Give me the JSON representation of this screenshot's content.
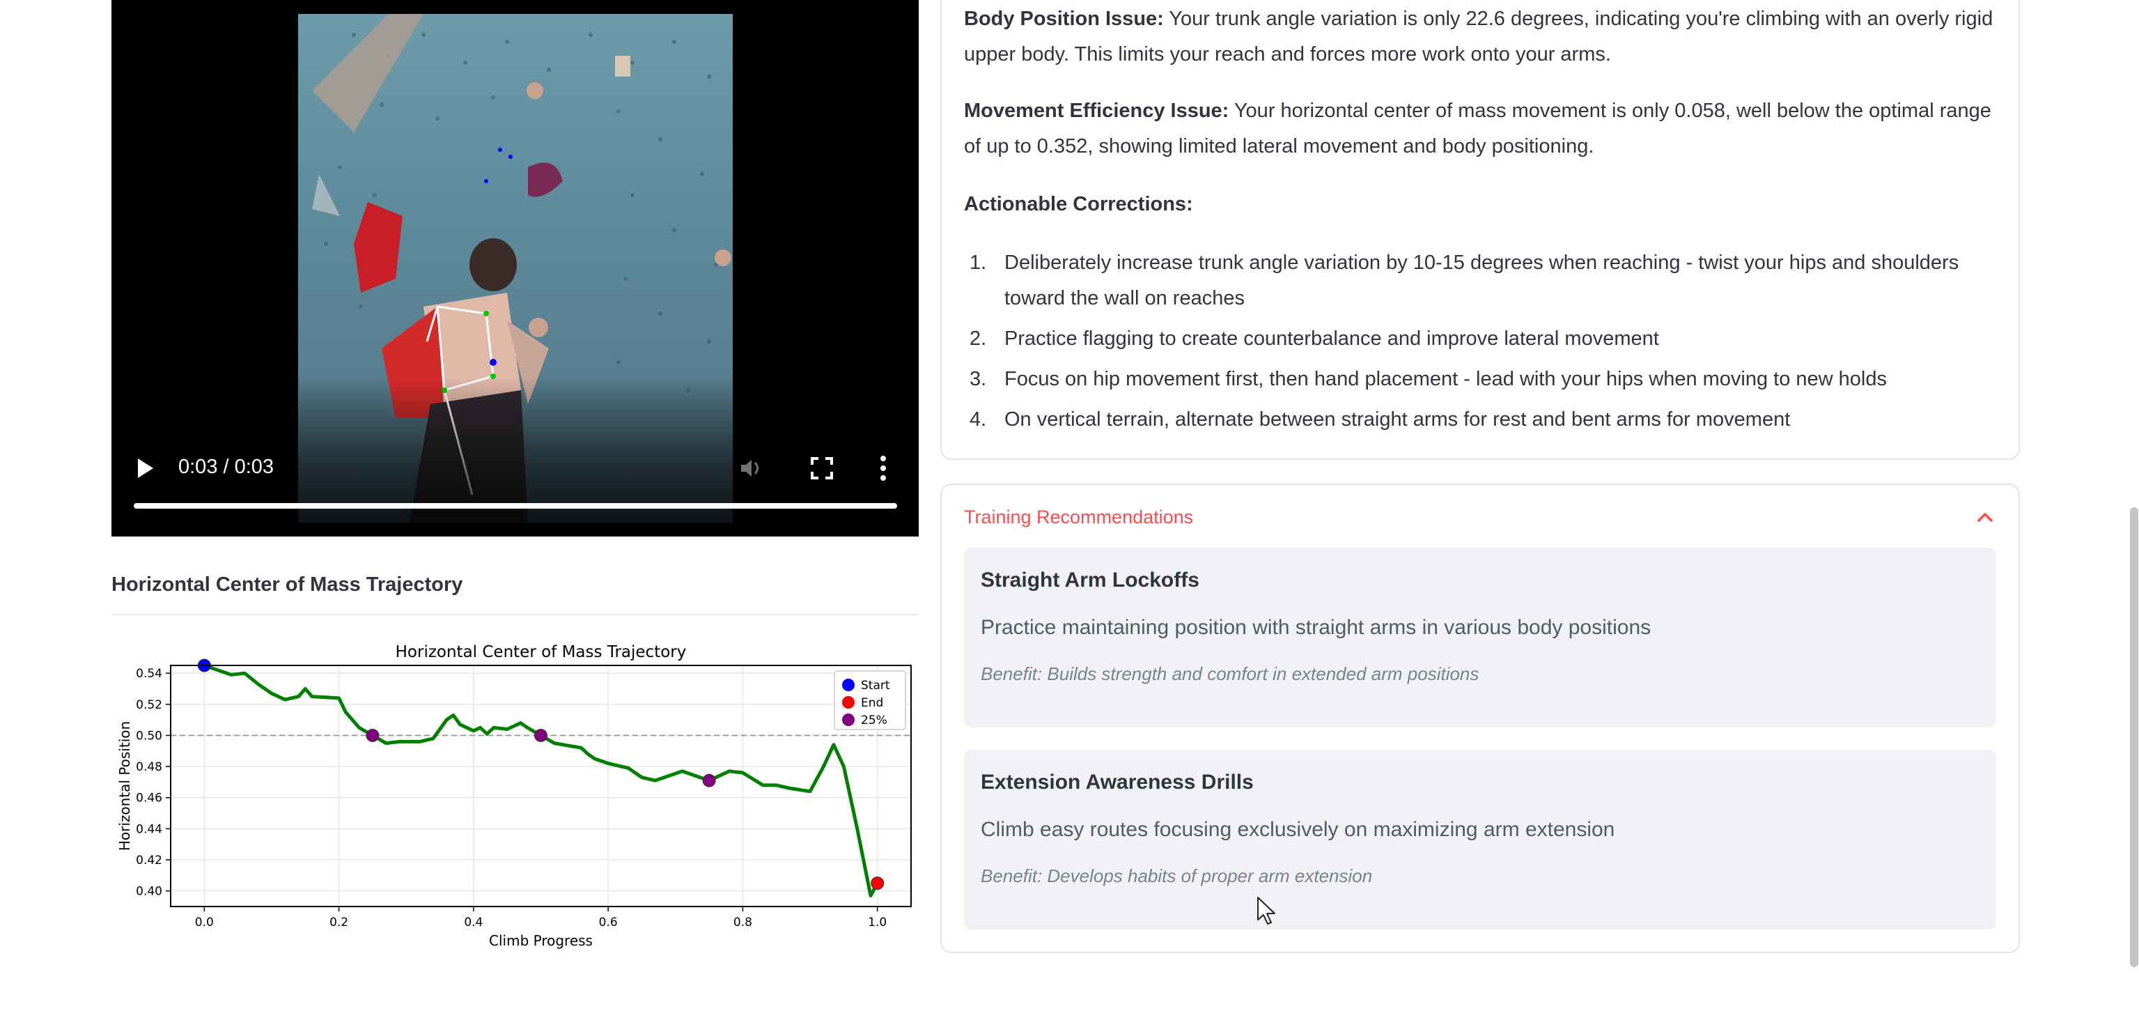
{
  "video": {
    "time_display": "0:03 / 0:03",
    "progress": 1.0,
    "icons": [
      "play-icon",
      "volume-icon",
      "fullscreen-icon",
      "more-vert-icon"
    ]
  },
  "chart_section": {
    "heading": "Horizontal Center of Mass Trajectory"
  },
  "chart_data": {
    "type": "line",
    "title": "Horizontal Center of Mass Trajectory",
    "xlabel": "Climb Progress",
    "ylabel": "Horizontal Position",
    "xlim": [
      -0.05,
      1.05
    ],
    "ylim": [
      0.39,
      0.545
    ],
    "xticks": [
      "0.0",
      "0.2",
      "0.4",
      "0.6",
      "0.8",
      "1.0"
    ],
    "yticks": [
      "0.40",
      "0.42",
      "0.44",
      "0.46",
      "0.48",
      "0.50",
      "0.52",
      "0.54"
    ],
    "grid": true,
    "legend_position": "top-right",
    "reference_line_y": 0.5,
    "series": [
      {
        "color": "#008000",
        "x": [
          0.0,
          0.02,
          0.04,
          0.06,
          0.08,
          0.1,
          0.12,
          0.14,
          0.15,
          0.16,
          0.2,
          0.21,
          0.23,
          0.25,
          0.27,
          0.29,
          0.32,
          0.34,
          0.36,
          0.37,
          0.38,
          0.4,
          0.41,
          0.42,
          0.43,
          0.45,
          0.47,
          0.48,
          0.5,
          0.52,
          0.56,
          0.57,
          0.58,
          0.6,
          0.63,
          0.65,
          0.67,
          0.69,
          0.71,
          0.73,
          0.75,
          0.78,
          0.8,
          0.83,
          0.85,
          0.87,
          0.9,
          0.92,
          0.935,
          0.95,
          0.97,
          0.99,
          1.0
        ],
        "y": [
          0.545,
          0.542,
          0.539,
          0.54,
          0.533,
          0.527,
          0.523,
          0.525,
          0.53,
          0.525,
          0.524,
          0.515,
          0.505,
          0.5,
          0.495,
          0.496,
          0.496,
          0.498,
          0.51,
          0.513,
          0.507,
          0.503,
          0.505,
          0.501,
          0.505,
          0.504,
          0.508,
          0.505,
          0.5,
          0.495,
          0.492,
          0.488,
          0.485,
          0.482,
          0.479,
          0.473,
          0.471,
          0.474,
          0.477,
          0.474,
          0.471,
          0.477,
          0.476,
          0.468,
          0.468,
          0.466,
          0.464,
          0.48,
          0.494,
          0.48,
          0.44,
          0.397,
          0.405
        ]
      }
    ],
    "markers": [
      {
        "label": "Start",
        "x": 0.0,
        "y": 0.545,
        "color": "#0000ff"
      },
      {
        "label": "End",
        "x": 1.0,
        "y": 0.405,
        "color": "#ff0000"
      },
      {
        "label": "25%",
        "x": 0.25,
        "y": 0.5,
        "color": "#800080"
      },
      {
        "x": 0.5,
        "y": 0.5,
        "color": "#800080"
      },
      {
        "x": 0.75,
        "y": 0.471,
        "color": "#800080"
      }
    ],
    "legend": [
      "Start",
      "End",
      "25%"
    ]
  },
  "feedback": {
    "body_position_label": "Body Position Issue:",
    "body_position_text": " Your trunk angle variation is only 22.6 degrees, indicating you're climbing with an overly rigid upper body. This limits your reach and forces more work onto your arms.",
    "movement_label": "Movement Efficiency Issue:",
    "movement_text": " Your horizontal center of mass movement is only 0.058, well below the optimal range of up to 0.352, showing limited lateral movement and body positioning.",
    "corrections_heading": "Actionable Corrections:",
    "corrections": [
      {
        "num": "1.",
        "text": "Deliberately increase trunk angle variation by 10-15 degrees when reaching - twist your hips and shoulders toward the wall on reaches"
      },
      {
        "num": "2.",
        "text": "Practice flagging to create counterbalance and improve lateral movement"
      },
      {
        "num": "3.",
        "text": "Focus on hip movement first, then hand placement - lead with your hips when moving to new holds"
      },
      {
        "num": "4.",
        "text": "On vertical terrain, alternate between straight arms for rest and bent arms for movement"
      }
    ]
  },
  "training": {
    "expander_label": "Training Recommendations",
    "expanded": true,
    "items": [
      {
        "title": "Straight Arm Lockoffs",
        "description": "Practice maintaining position with straight arms in various body positions",
        "benefit": "Benefit: Builds strength and comfort in extended arm positions"
      },
      {
        "title": "Extension Awareness Drills",
        "description": "Climb easy routes focusing exclusively on maximizing arm extension",
        "benefit": "Benefit: Develops habits of proper arm extension"
      }
    ]
  },
  "colors": {
    "accent": "#ff4b4b",
    "text": "#31333f",
    "card_border": "#e1e3e8",
    "rec_bg": "#f0f2f6"
  }
}
